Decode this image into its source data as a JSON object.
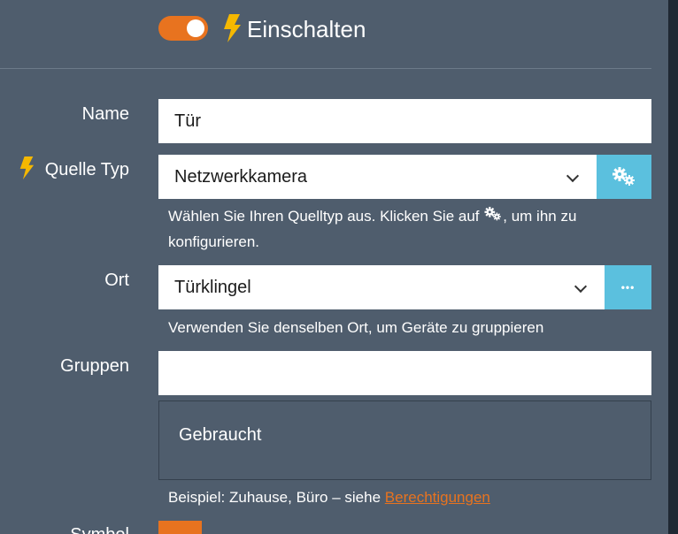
{
  "colors": {
    "background": "#4f5d6d",
    "accent": "#e8731f",
    "bolt": "#f5b800",
    "addon": "#5bc0de"
  },
  "enable": {
    "label": "Einschalten",
    "on": true
  },
  "name": {
    "label": "Name",
    "value": "Tür"
  },
  "source_type": {
    "label": "Quelle Typ",
    "selected": "Netzwerkkamera",
    "help_before": "Wählen Sie Ihren Quelltyp aus. Klicken Sie auf",
    "help_after": ", um ihn zu",
    "help_line2": "konfigurieren.",
    "icon": "gears-icon"
  },
  "location": {
    "label": "Ort",
    "selected": "Türklingel",
    "help": "Verwenden Sie denselben Ort, um Geräte zu gruppieren",
    "addon": "•••"
  },
  "groups": {
    "label": "Gruppen",
    "value": "",
    "used_label": "Gebraucht",
    "help_prefix": "Beispiel: Zuhause, Büro – siehe",
    "help_link": "Berechtigungen"
  },
  "symbol": {
    "label": "Symbol"
  }
}
